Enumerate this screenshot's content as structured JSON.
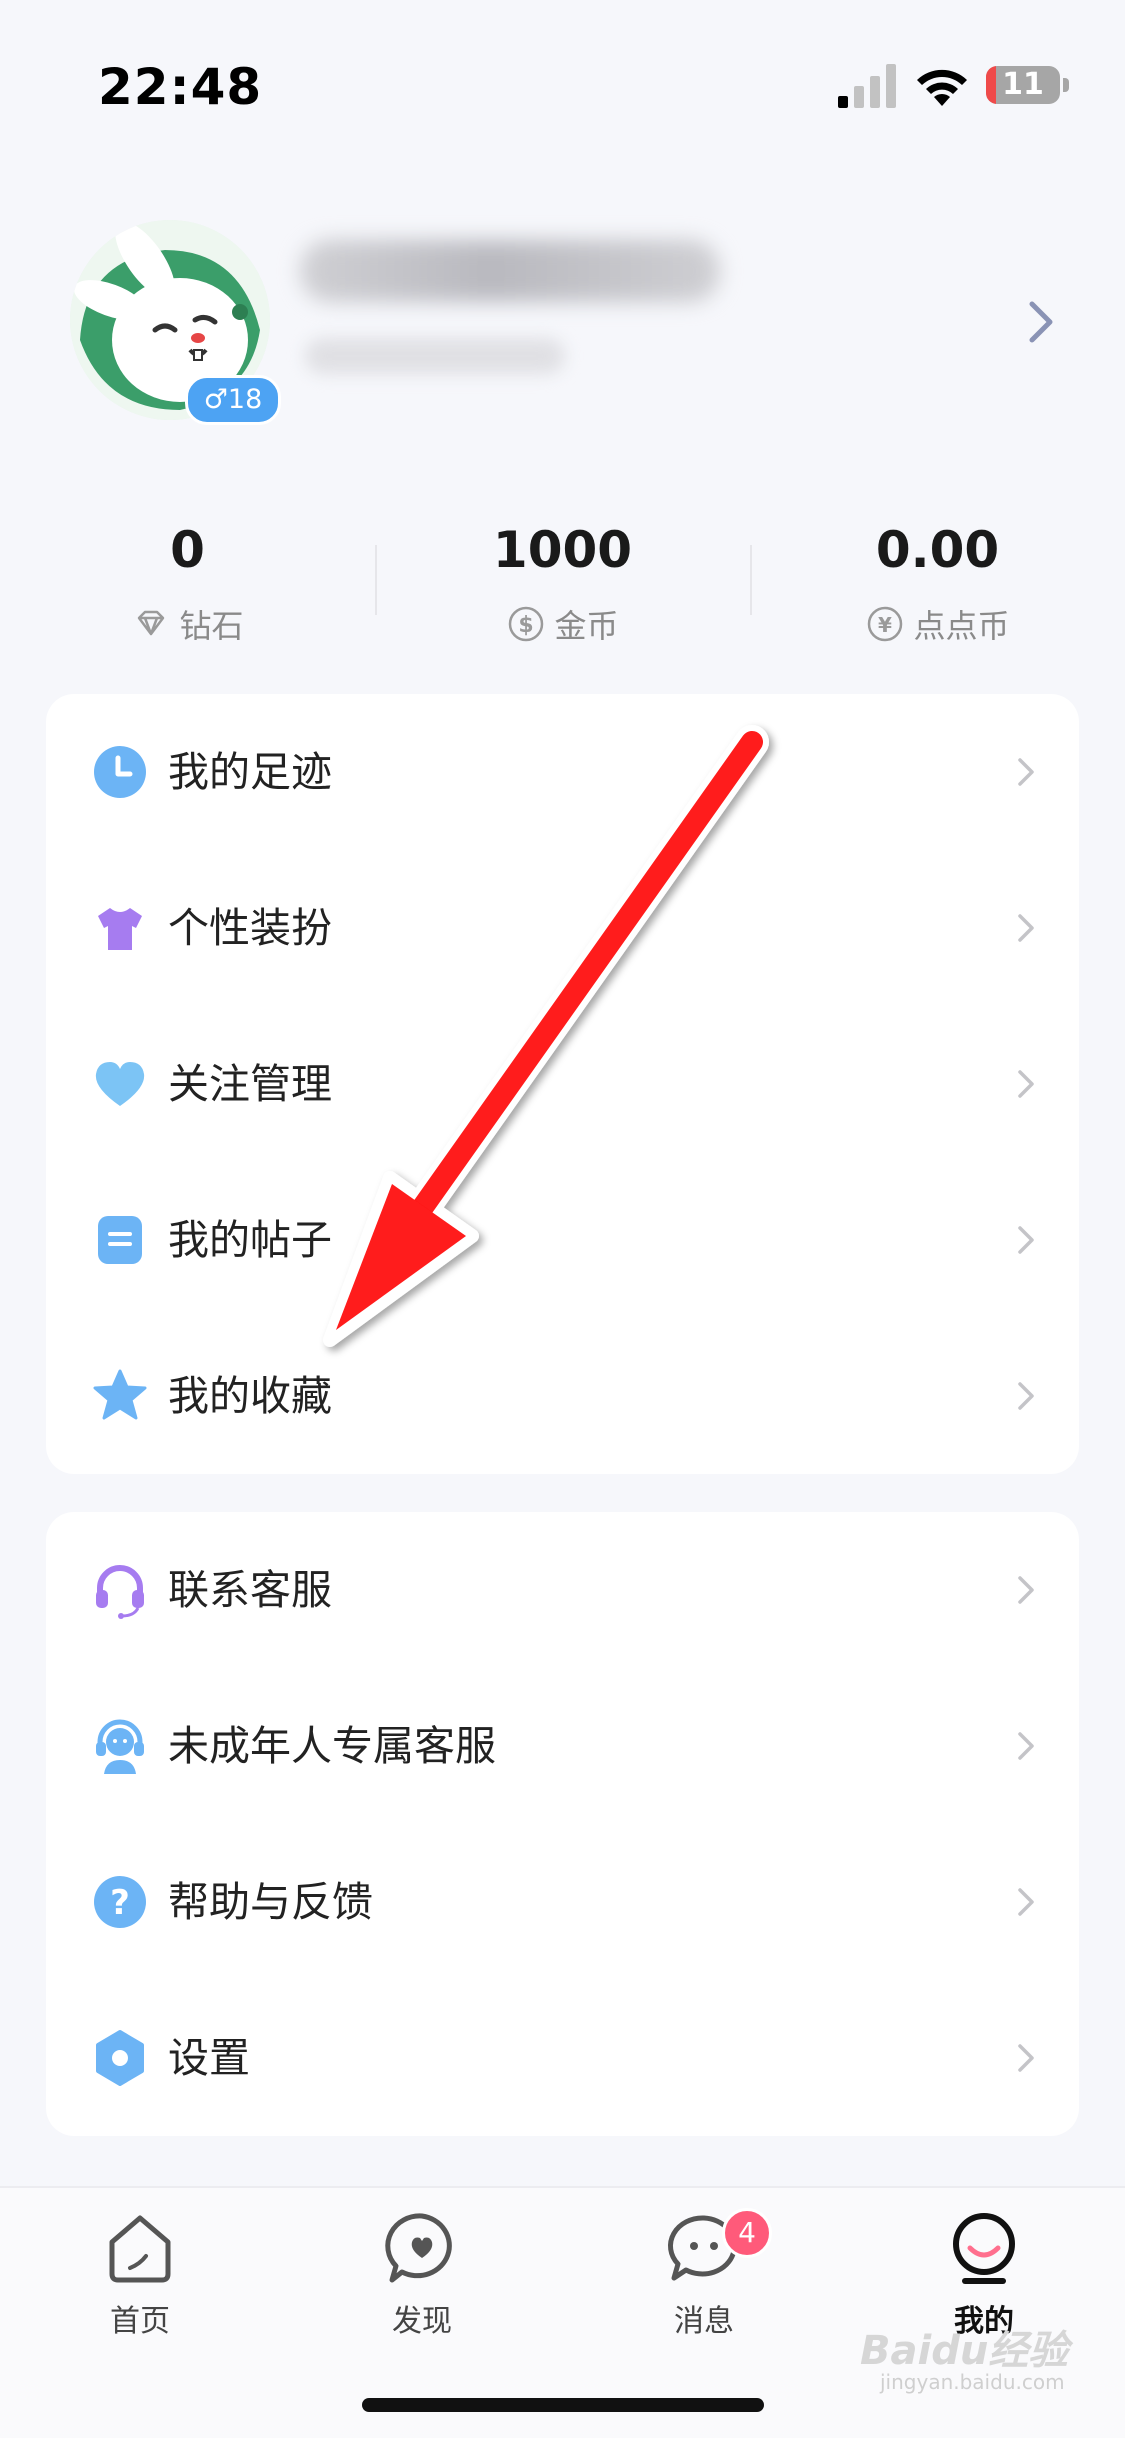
{
  "status_bar": {
    "time": "22:48",
    "battery": "11"
  },
  "profile": {
    "gender_age": "♂18"
  },
  "stats": [
    {
      "value": "0",
      "label": "钻石",
      "icon": "diamond-icon"
    },
    {
      "value": "1000",
      "label": "金币",
      "icon": "dollar-coin-icon"
    },
    {
      "value": "0.00",
      "label": "点点币",
      "icon": "yen-coin-icon"
    }
  ],
  "menu_group_1": [
    {
      "label": "我的足迹",
      "icon": "clock-icon"
    },
    {
      "label": "个性装扮",
      "icon": "tshirt-icon"
    },
    {
      "label": "关注管理",
      "icon": "heart-icon"
    },
    {
      "label": "我的帖子",
      "icon": "document-icon"
    },
    {
      "label": "我的收藏",
      "icon": "star-icon"
    }
  ],
  "menu_group_2": [
    {
      "label": "联系客服",
      "icon": "headset-icon"
    },
    {
      "label": "未成年人专属客服",
      "icon": "support-agent-icon"
    },
    {
      "label": "帮助与反馈",
      "icon": "question-icon"
    },
    {
      "label": "设置",
      "icon": "settings-gear-icon"
    }
  ],
  "tabbar": {
    "home": "首页",
    "discover": "发现",
    "messages": "消息",
    "messages_badge": "4",
    "me": "我的"
  },
  "watermark": {
    "logo": "Baidu经验",
    "url": "jingyan.baidu.com"
  },
  "colors": {
    "accent_blue": "#4da3f3",
    "arrow_red": "#ff1a1a",
    "badge_pink": "#ff5a7a"
  }
}
